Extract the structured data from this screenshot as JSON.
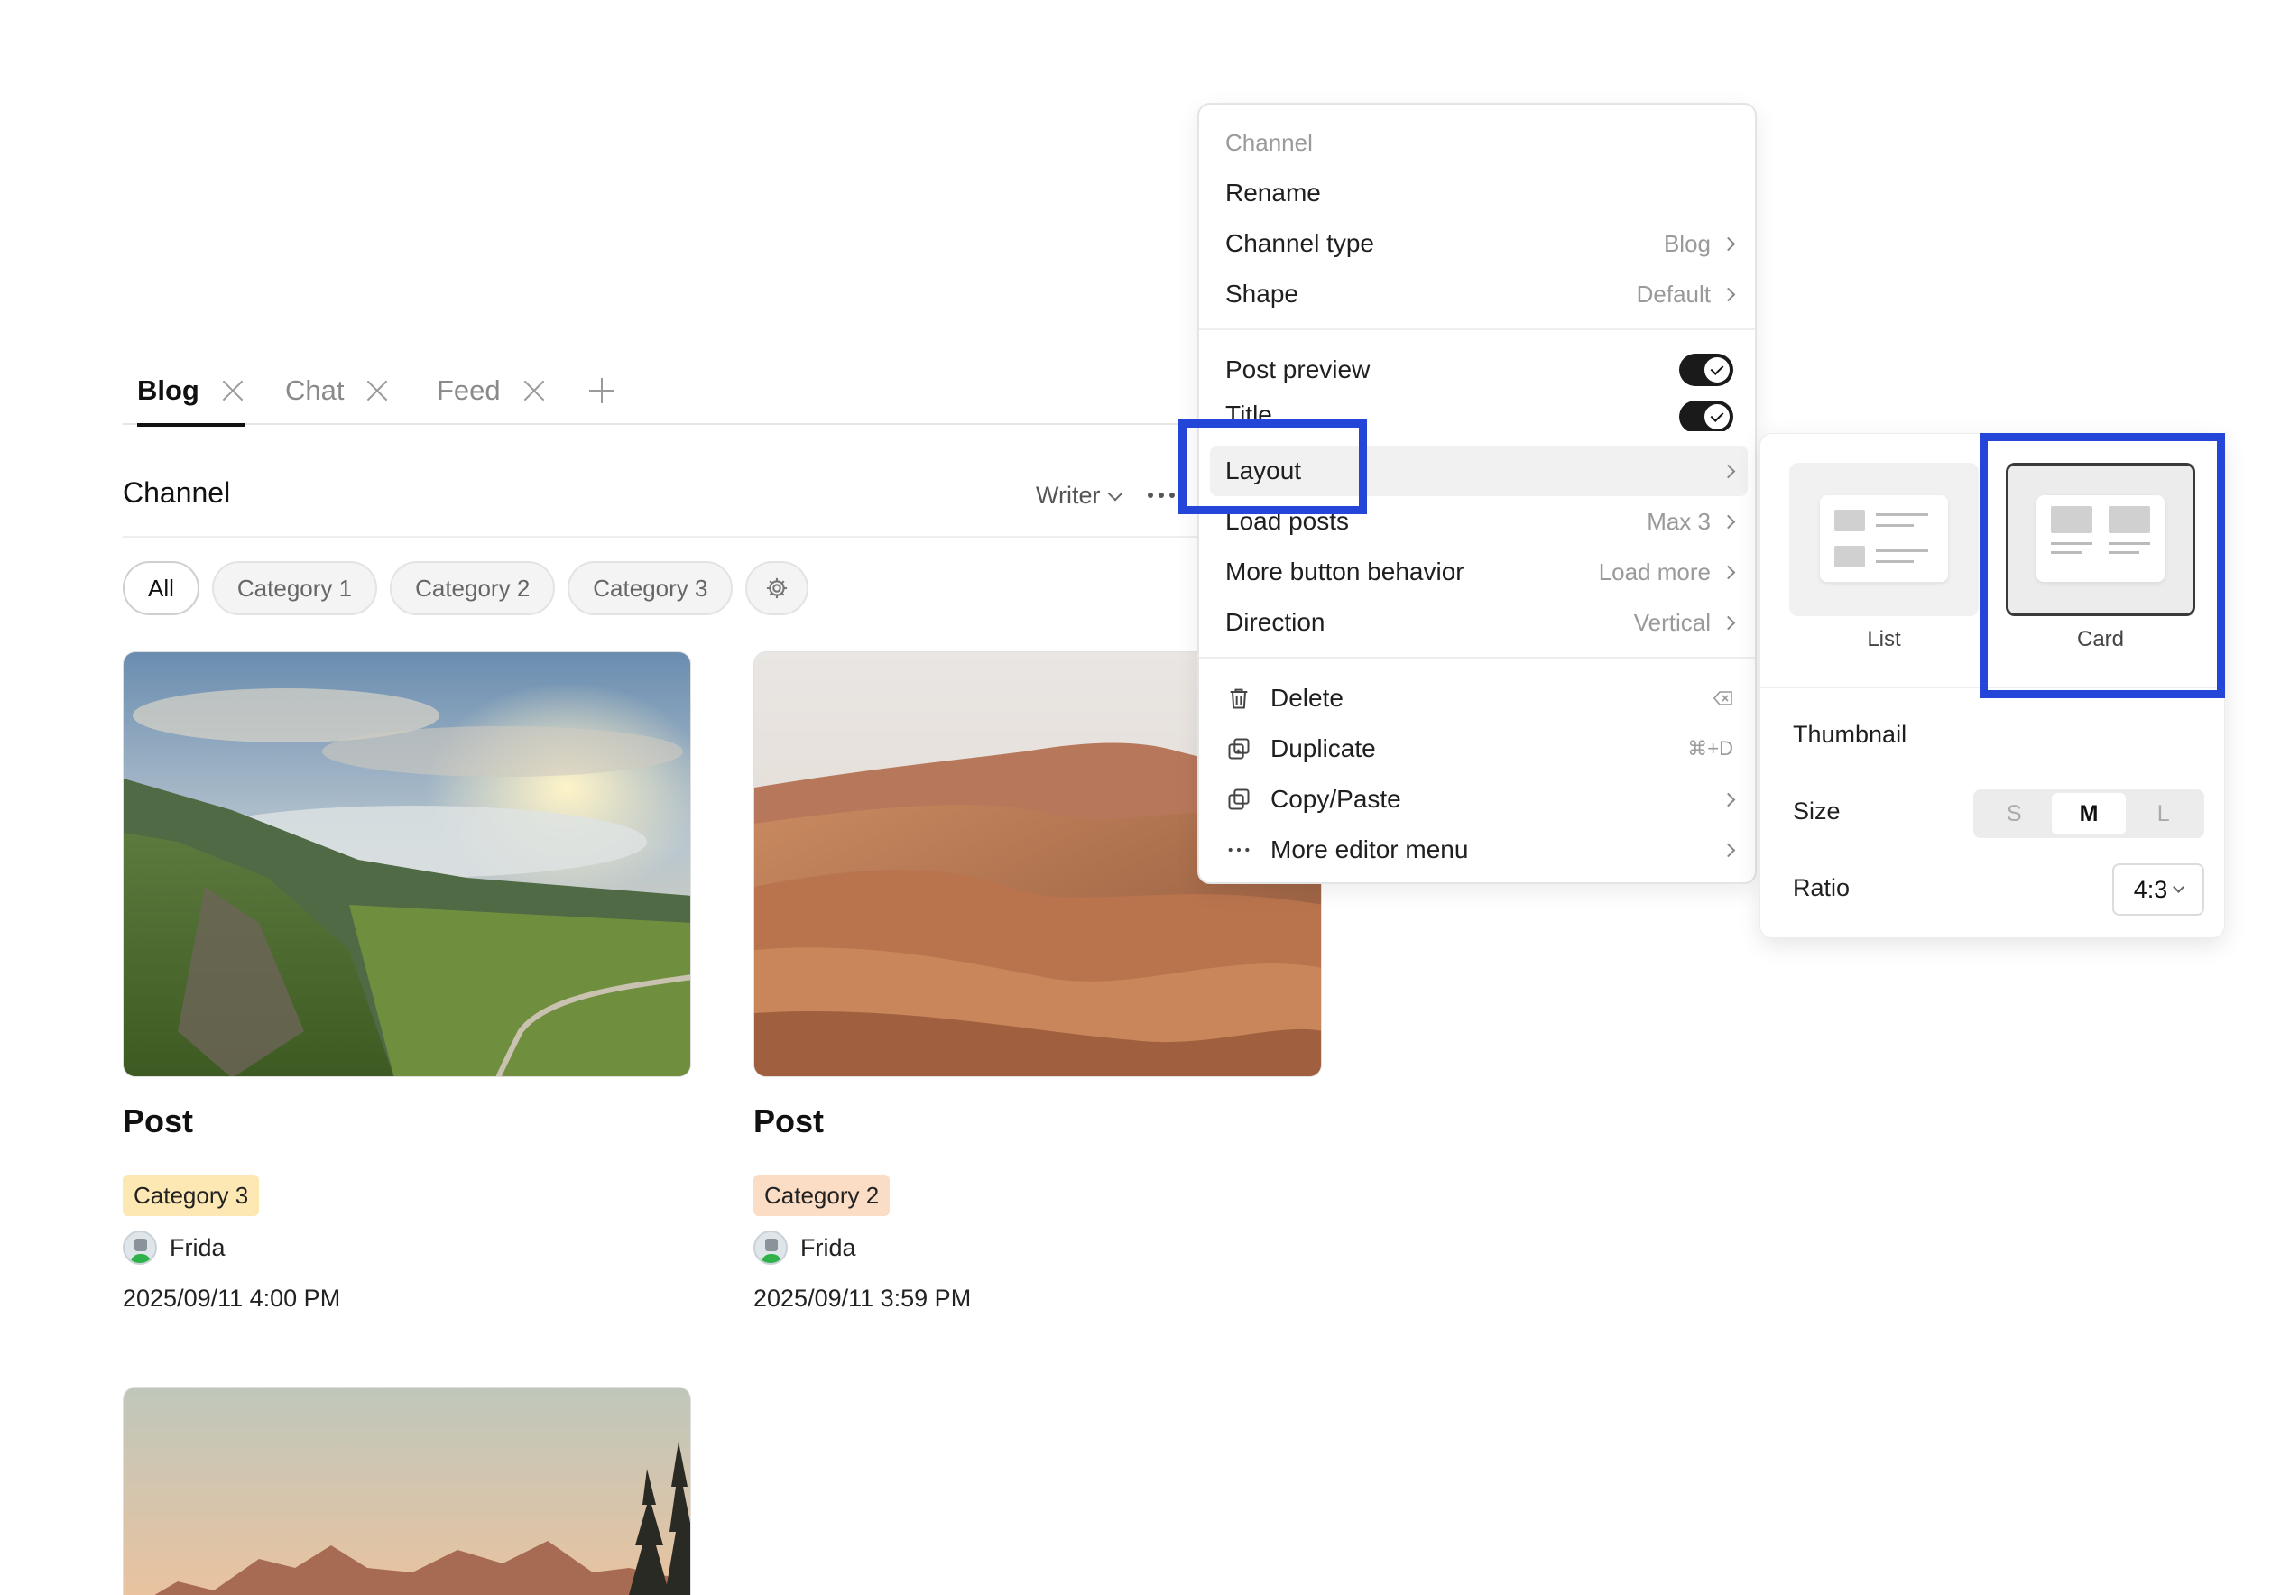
{
  "tabs": [
    {
      "label": "Blog",
      "active": true
    },
    {
      "label": "Chat",
      "active": false
    },
    {
      "label": "Feed",
      "active": false
    }
  ],
  "channel": {
    "title": "Channel",
    "writer_label": "Writer"
  },
  "filters": {
    "chips": [
      "All",
      "Category 1",
      "Category 2",
      "Category 3"
    ]
  },
  "posts": [
    {
      "title": "Post",
      "category": "Category 3",
      "category_color": "#fde8b4",
      "author": "Frida",
      "date": "2025/09/11 4:00 PM"
    },
    {
      "title": "Post",
      "category": "Category 2",
      "category_color": "#fbdcc4",
      "author": "Frida",
      "date": "2025/09/11 3:59 PM"
    }
  ],
  "menu": {
    "section_label": "Channel",
    "rename": "Rename",
    "channel_type": {
      "label": "Channel type",
      "value": "Blog"
    },
    "shape": {
      "label": "Shape",
      "value": "Default"
    },
    "post_preview": {
      "label": "Post preview",
      "on": true
    },
    "title_toggle": {
      "label": "Title",
      "on": true
    },
    "layout": {
      "label": "Layout"
    },
    "load_posts": {
      "label": "Load posts",
      "value": "Max 3"
    },
    "more_button": {
      "label": "More button behavior",
      "value": "Load more"
    },
    "direction": {
      "label": "Direction",
      "value": "Vertical"
    },
    "delete": {
      "label": "Delete"
    },
    "duplicate": {
      "label": "Duplicate",
      "shortcut": "⌘+D"
    },
    "copy_paste": {
      "label": "Copy/Paste"
    },
    "more_editor": {
      "label": "More editor menu"
    }
  },
  "layout_panel": {
    "options": [
      {
        "label": "List",
        "selected": false
      },
      {
        "label": "Card",
        "selected": true
      }
    ],
    "thumbnail_label": "Thumbnail",
    "size_label": "Size",
    "sizes": [
      "S",
      "M",
      "L"
    ],
    "selected_size": "M",
    "ratio_label": "Ratio",
    "ratio_value": "4:3"
  },
  "colors": {
    "highlight": "#2446d8",
    "toggle_on": "#1a1a1a"
  }
}
